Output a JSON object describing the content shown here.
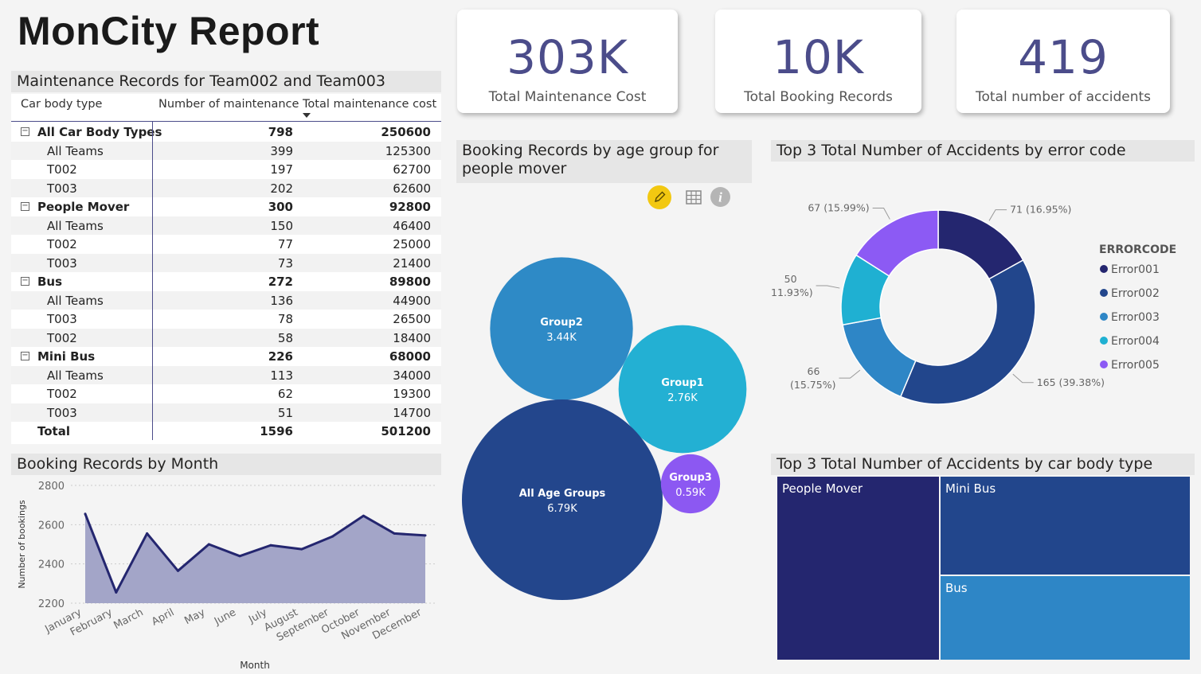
{
  "report": {
    "title": "MonCity Report"
  },
  "kpis": [
    {
      "value": "303K",
      "label": "Total Maintenance Cost"
    },
    {
      "value": "10K",
      "label": "Total Booking Records"
    },
    {
      "value": "419",
      "label": "Total number of accidents"
    }
  ],
  "maintenance": {
    "title": "Maintenance Records for Team002 and Team003",
    "columns": [
      "Car body type",
      "Number of maintenance",
      "Total maintenance cost"
    ],
    "rows": [
      {
        "label": "All Car Body Types",
        "count": "798",
        "cost": "250600",
        "group": true
      },
      {
        "label": "All Teams",
        "count": "399",
        "cost": "125300"
      },
      {
        "label": "T002",
        "count": "197",
        "cost": "62700"
      },
      {
        "label": "T003",
        "count": "202",
        "cost": "62600"
      },
      {
        "label": "People Mover",
        "count": "300",
        "cost": "92800",
        "group": true
      },
      {
        "label": "All Teams",
        "count": "150",
        "cost": "46400"
      },
      {
        "label": "T002",
        "count": "77",
        "cost": "25000"
      },
      {
        "label": "T003",
        "count": "73",
        "cost": "21400"
      },
      {
        "label": "Bus",
        "count": "272",
        "cost": "89800",
        "group": true
      },
      {
        "label": "All Teams",
        "count": "136",
        "cost": "44900"
      },
      {
        "label": "T003",
        "count": "78",
        "cost": "26500"
      },
      {
        "label": "T002",
        "count": "58",
        "cost": "18400"
      },
      {
        "label": "Mini Bus",
        "count": "226",
        "cost": "68000",
        "group": true
      },
      {
        "label": "All Teams",
        "count": "113",
        "cost": "34000"
      },
      {
        "label": "T002",
        "count": "62",
        "cost": "19300"
      },
      {
        "label": "T003",
        "count": "51",
        "cost": "14700"
      }
    ],
    "total": {
      "label": "Total",
      "count": "1596",
      "cost": "501200"
    },
    "expander_glyph": "−"
  },
  "bubble": {
    "title": "Booking Records by age group for people mover",
    "icons": [
      "pencil-icon",
      "table-icon",
      "info-icon"
    ],
    "accent": "#f2c811"
  },
  "donut": {
    "title": "Top 3 Total Number of Accidents by error code",
    "legend_title": "ERRORCODE"
  },
  "treemap": {
    "title": "Top 3 Total Number of Accidents by car body type"
  },
  "line": {
    "title": "Booking Records by Month"
  },
  "chart_data": [
    {
      "type": "bubble",
      "title": "Booking Records by age group for people mover",
      "points": [
        {
          "name": "Group2",
          "value": 3440,
          "label": "3.44K",
          "color": "#2e8ac6"
        },
        {
          "name": "Group1",
          "value": 2760,
          "label": "2.76K",
          "color": "#23b0d3"
        },
        {
          "name": "All Age Groups",
          "value": 6790,
          "label": "6.79K",
          "color": "#23468c"
        },
        {
          "name": "Group3",
          "value": 590,
          "label": "0.59K",
          "color": "#8c58f2"
        }
      ]
    },
    {
      "type": "pie",
      "donut": true,
      "title": "Top 3 Total Number of Accidents by error code",
      "legend_title": "ERRORCODE",
      "legend_position": "right",
      "slices": [
        {
          "name": "Error001",
          "value": 71,
          "label": "71 (16.95%)",
          "color": "#24266f"
        },
        {
          "name": "Error002",
          "value": 165,
          "label": "165 (39.38%)",
          "color": "#22468c"
        },
        {
          "name": "Error003",
          "value": 66,
          "label": "66 (15.75%)",
          "color": "#2e86c6"
        },
        {
          "name": "Error004",
          "value": 50,
          "label": "50 (11.93%)",
          "color": "#1fb0d2"
        },
        {
          "name": "Error005",
          "value": 67,
          "label": "67 (15.99%)",
          "color": "#8c5af4"
        }
      ]
    },
    {
      "type": "treemap",
      "title": "Top 3 Total Number of Accidents by car body type",
      "items": [
        {
          "name": "People Mover",
          "color": "#24266f"
        },
        {
          "name": "Mini Bus",
          "color": "#22468c"
        },
        {
          "name": "Bus",
          "color": "#2e86c6"
        }
      ]
    },
    {
      "type": "area",
      "title": "Booking Records by Month",
      "xlabel": "Month",
      "ylabel": "Number of bookings",
      "categories": [
        "January",
        "February",
        "March",
        "April",
        "May",
        "June",
        "July",
        "August",
        "September",
        "October",
        "November",
        "December"
      ],
      "values": [
        2655,
        2255,
        2555,
        2365,
        2500,
        2440,
        2495,
        2475,
        2540,
        2645,
        2555,
        2545
      ],
      "ylim": [
        2200,
        2800
      ],
      "yticks": [
        2200,
        2400,
        2600,
        2800
      ],
      "line_color": "#24266f",
      "fill_color": "#a3a5c8",
      "grid": true
    }
  ]
}
